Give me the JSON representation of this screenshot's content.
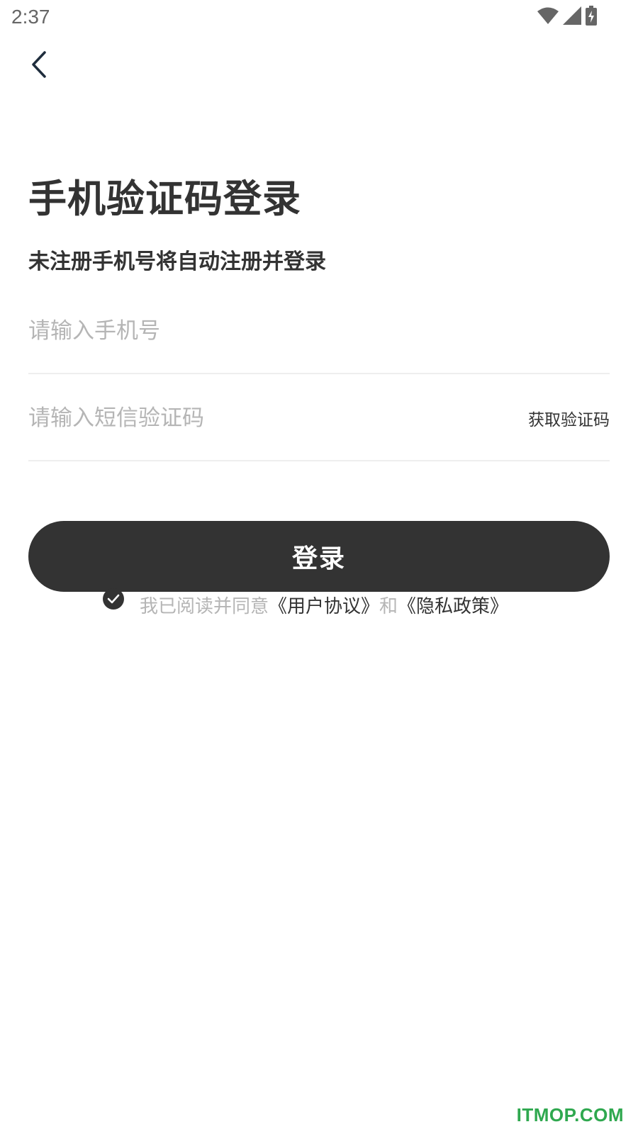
{
  "status_bar": {
    "time": "2:37",
    "icons": [
      "wifi-icon",
      "signal-icon",
      "battery-charging-icon"
    ]
  },
  "header": {
    "back_icon": "chevron-left-icon"
  },
  "title": "手机验证码登录",
  "subtitle": "未注册手机号将自动注册并登录",
  "form": {
    "phone_placeholder": "请输入手机号",
    "phone_value": "",
    "code_placeholder": "请输入短信验证码",
    "code_value": "",
    "get_code_label": "获取验证码"
  },
  "login_button": {
    "label": "登录"
  },
  "agreement": {
    "checked": true,
    "prefix": "我已阅读并同意",
    "user_agreement": "《用户协议》",
    "conjunction": "和",
    "privacy_policy": "《隐私政策》"
  },
  "watermark": "ITMOP.COM",
  "colors": {
    "primary": "#333333",
    "placeholder": "#b5b5b5",
    "divider": "#eeeeee",
    "background": "#ffffff",
    "watermark": "#2fa84f"
  }
}
